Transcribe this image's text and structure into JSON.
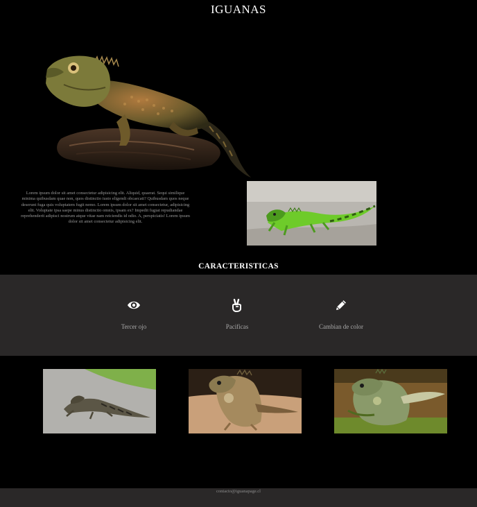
{
  "header": {
    "title": "IGUANAS"
  },
  "intro": {
    "text": "Lorem ipsum dolor sit amet consectetur adipisicing elit. Aliquid, quaerat. Sequi similique minima quibusdam quae non, quos distinctio iusto eligendi obcaecati? Quibusdam quos neque deserunt fuga quis voluptatem fugit nemo. Lorem ipsum dolor sit amet consectetur, adipisicing elit. Voluptate ipsa saepe minus distinctio omnis, ipsam ex? Impedit fugiat repudiandae reprehenderit adipisci nostrum atque vitae nam reiciendis id odio. A, perspiciatis! Lorem ipsum dolor sit amet consectetur adipisicing elit."
  },
  "features": {
    "heading": "CARACTERISTICAS",
    "items": [
      {
        "label": "Tercer ojo",
        "icon": "eye-icon"
      },
      {
        "label": "Pacificas",
        "icon": "peace-hand-icon"
      },
      {
        "label": "Cambian de color",
        "icon": "pencil-icon"
      }
    ]
  },
  "footer": {
    "email": "contacto@iguanapage.cl"
  },
  "colors": {
    "background": "#000000",
    "section_band": "#2a2828",
    "text_muted": "#9a9a9a",
    "heading": "#ffffff"
  }
}
